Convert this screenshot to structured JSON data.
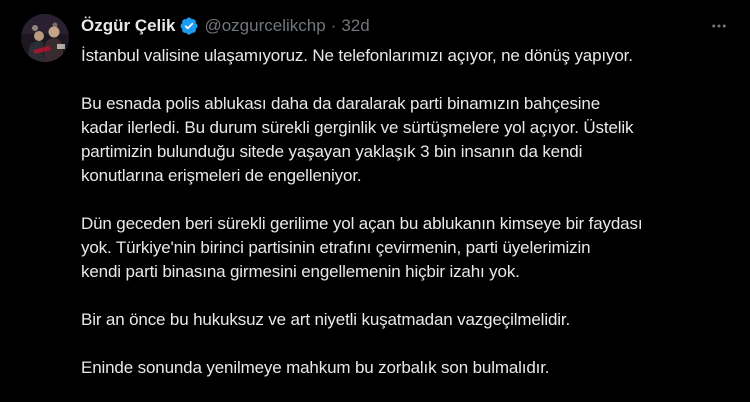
{
  "tweet": {
    "author": {
      "display_name": "Özgür Çelik",
      "handle": "@ozgurcelikchp",
      "verified_icon": "verified-badge-icon",
      "verified_color": "#1d9bf0"
    },
    "separator": "·",
    "time": "32d",
    "more_icon": "more-horizontal-icon",
    "paragraphs": [
      {
        "lines": [
          "İstanbul valisine ulaşamıyoruz. Ne telefonlarımızı açıyor, ne dönüş yapıyor."
        ]
      },
      {
        "lines": [
          "Bu esnada polis ablukası daha da daralarak parti binamızın bahçesine",
          "kadar ilerledi. Bu durum sürekli gerginlik ve sürtüşmelere yol açıyor. Üstelik",
          "partimizin bulunduğu sitede yaşayan yaklaşık 3 bin insanın da kendi",
          "konutlarına erişmeleri de engelleniyor."
        ]
      },
      {
        "lines": [
          "Dün geceden beri sürekli gerilime yol açan bu ablukanın kimseye bir faydası",
          "yok. Türkiye'nin birinci partisinin etrafını çevirmenin, parti üyelerimizin",
          "kendi parti binasına girmesini engellemenin hiçbir izahı yok."
        ]
      },
      {
        "lines": [
          "Bir an önce bu hukuksuz ve art niyetli kuşatmadan vazgeçilmelidir."
        ]
      },
      {
        "lines": [
          "Eninde sonunda yenilmeye mahkum bu zorbalık son bulmalıdır."
        ]
      }
    ]
  }
}
